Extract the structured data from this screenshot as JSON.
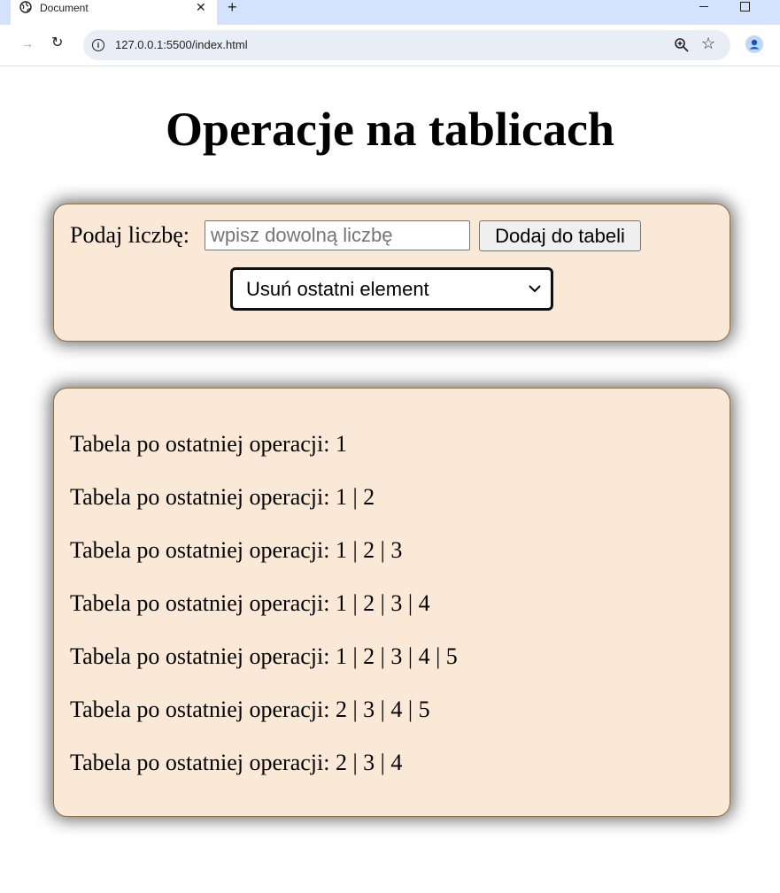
{
  "browser": {
    "tab_title": "Document",
    "url": "127.0.0.1:5500/index.html",
    "tab_close": "✕",
    "new_tab": "+"
  },
  "page": {
    "title": "Operacje na tablicach",
    "form": {
      "label": "Podaj liczbę:",
      "input_value": "",
      "input_placeholder": "wpisz dowolną liczbę",
      "add_button": "Dodaj do tabeli",
      "operation_selected": "Usuń ostatni element"
    },
    "results": [
      "Tabela po ostatniej operacji: 1",
      "Tabela po ostatniej operacji: 1 | 2",
      "Tabela po ostatniej operacji: 1 | 2 | 3",
      "Tabela po ostatniej operacji: 1 | 2 | 3 | 4",
      "Tabela po ostatniej operacji: 1 | 2 | 3 | 4 | 5",
      "Tabela po ostatniej operacji: 2 | 3 | 4 | 5",
      "Tabela po ostatniej operacji: 2 | 3 | 4"
    ]
  },
  "colors": {
    "panel_bg": "#fae9d7",
    "panel_border": "#8b6f4b",
    "tabbar_bg": "#d3e3fd"
  },
  "icons": [
    "globe-icon",
    "close-icon",
    "new-tab-icon",
    "minimize-icon",
    "maximize-icon",
    "forward-icon",
    "reload-icon",
    "info-icon",
    "zoom-icon",
    "star-icon",
    "profile-icon",
    "chevron-down-icon"
  ]
}
